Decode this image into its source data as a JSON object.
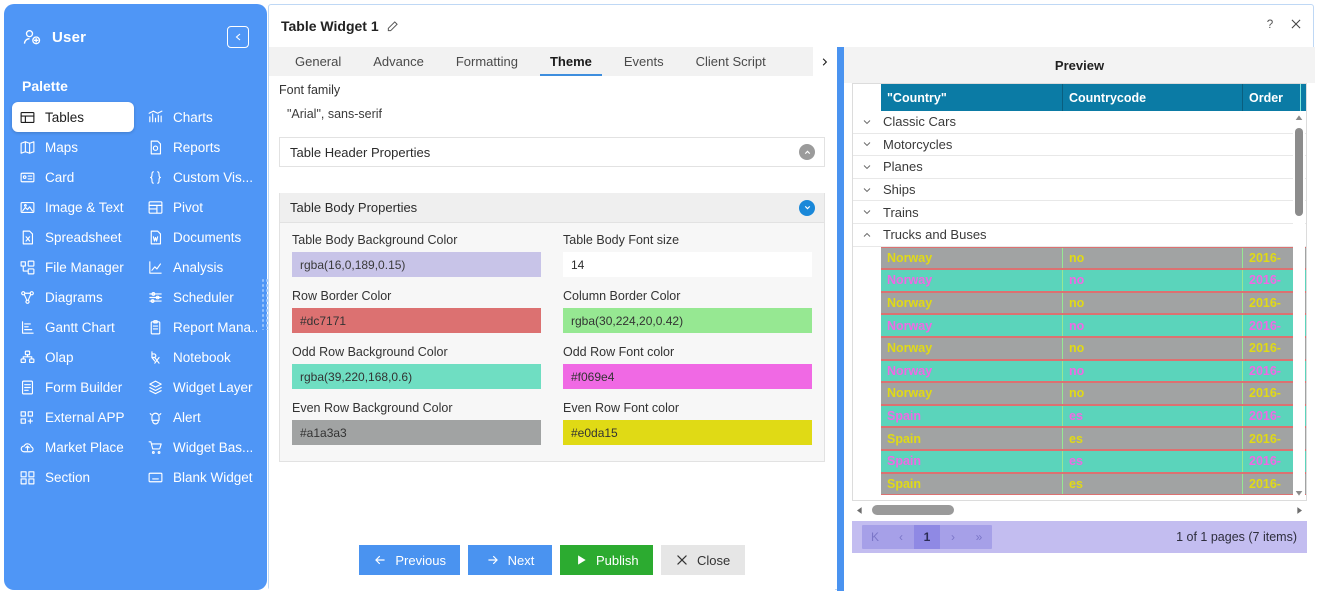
{
  "sidebar": {
    "user_label": "User",
    "user_icon": "user-gear-icon",
    "collapse_icon": "collapse-left-icon",
    "palette_title": "Palette",
    "items": [
      {
        "label": "Tables",
        "icon": "table-icon",
        "active": true
      },
      {
        "label": "Charts",
        "icon": "chart-icon",
        "active": false
      },
      {
        "label": "Maps",
        "icon": "map-icon",
        "active": false
      },
      {
        "label": "Reports",
        "icon": "report-icon",
        "active": false
      },
      {
        "label": "Card",
        "icon": "card-icon",
        "active": false
      },
      {
        "label": "Custom Vis...",
        "icon": "braces-icon",
        "active": false
      },
      {
        "label": "Image & Text",
        "icon": "image-text-icon",
        "active": false
      },
      {
        "label": "Pivot",
        "icon": "pivot-icon",
        "active": false
      },
      {
        "label": "Spreadsheet",
        "icon": "spreadsheet-icon",
        "active": false
      },
      {
        "label": "Documents",
        "icon": "document-icon",
        "active": false
      },
      {
        "label": "File Manager",
        "icon": "file-manager-icon",
        "active": false
      },
      {
        "label": "Analysis",
        "icon": "analysis-icon",
        "active": false
      },
      {
        "label": "Diagrams",
        "icon": "diagram-icon",
        "active": false
      },
      {
        "label": "Scheduler",
        "icon": "scheduler-icon",
        "active": false
      },
      {
        "label": "Gantt Chart",
        "icon": "gantt-icon",
        "active": false
      },
      {
        "label": "Report Mana...",
        "icon": "clipboard-icon",
        "active": false
      },
      {
        "label": "Olap",
        "icon": "olap-icon",
        "active": false
      },
      {
        "label": "Notebook",
        "icon": "notebook-icon",
        "active": false
      },
      {
        "label": "Form Builder",
        "icon": "form-icon",
        "active": false
      },
      {
        "label": "Widget Layer",
        "icon": "layers-icon",
        "active": false
      },
      {
        "label": "External APP",
        "icon": "external-app-icon",
        "active": false
      },
      {
        "label": "Alert",
        "icon": "bell-icon",
        "active": false
      },
      {
        "label": "Market Place",
        "icon": "cloud-up-icon",
        "active": false
      },
      {
        "label": "Widget Bas...",
        "icon": "cart-icon",
        "active": false
      },
      {
        "label": "Section",
        "icon": "section-icon",
        "active": false
      },
      {
        "label": "Blank Widget",
        "icon": "blank-widget-icon",
        "active": false
      }
    ]
  },
  "dialog": {
    "title": "Table Widget 1",
    "edit_icon": "edit-pencil-icon",
    "help_icon": "question-mark-icon",
    "close_icon": "close-x-icon",
    "tabs": [
      {
        "label": "General",
        "active": false
      },
      {
        "label": "Advance",
        "active": false
      },
      {
        "label": "Formatting",
        "active": false
      },
      {
        "label": "Theme",
        "active": true
      },
      {
        "label": "Events",
        "active": false
      },
      {
        "label": "Client Script",
        "active": false
      }
    ],
    "tab_more_icon": "chevron-right-icon",
    "font_family": {
      "label": "Font family",
      "value": "\"Arial\", sans-serif"
    },
    "sections": [
      {
        "title": "Table Header Properties",
        "open": false,
        "chevron": "chevron-up-icon"
      },
      {
        "title": "Table Body Properties",
        "open": true,
        "chevron": "chevron-down-icon"
      }
    ],
    "body_properties": [
      {
        "label": "Table Body Background Color",
        "value": "rgba(16,0,189,0.15)",
        "swatch": "#c8c4e8",
        "text_color": "#3a3a3a"
      },
      {
        "label": "Table Body Font size",
        "value": "14",
        "swatch": "#ffffff",
        "text_color": "#2d2d2d"
      },
      {
        "label": "Row Border Color",
        "value": "#dc7171",
        "swatch": "#dc7171",
        "text_color": "#333333"
      },
      {
        "label": "Column Border Color",
        "value": "rgba(30,224,20,0.42)",
        "swatch": "#96e892",
        "text_color": "#333333"
      },
      {
        "label": "Odd Row Background Color",
        "value": "rgba(39,220,168,0.6)",
        "swatch": "#6fdec2",
        "text_color": "#333333"
      },
      {
        "label": "Odd Row Font color",
        "value": "#f069e4",
        "swatch": "#f069e4",
        "text_color": "#333333"
      },
      {
        "label": "Even Row Background Color",
        "value": "#a1a3a3",
        "swatch": "#a1a3a3",
        "text_color": "#333333"
      },
      {
        "label": "Even Row Font color",
        "value": "#e0da15",
        "swatch": "#e0da15",
        "text_color": "#333333"
      }
    ],
    "footer_buttons": [
      {
        "label": "Previous",
        "icon": "arrow-left-icon",
        "style": "blue"
      },
      {
        "label": "Next",
        "icon": "arrow-right-icon",
        "style": "blue"
      },
      {
        "label": "Publish",
        "icon": "play-icon",
        "style": "green"
      },
      {
        "label": "Close",
        "icon": "close-x-icon",
        "style": "grey"
      }
    ]
  },
  "preview": {
    "title": "Preview",
    "columns": [
      "\"Country\"",
      "Countrycode",
      "Order"
    ],
    "group_rows": [
      {
        "label": "Classic Cars",
        "expanded": false,
        "chevron": "chevron-down-icon"
      },
      {
        "label": "Motorcycles",
        "expanded": false,
        "chevron": "chevron-down-icon"
      },
      {
        "label": "Planes",
        "expanded": false,
        "chevron": "chevron-down-icon"
      },
      {
        "label": "Ships",
        "expanded": false,
        "chevron": "chevron-down-icon"
      },
      {
        "label": "Trains",
        "expanded": false,
        "chevron": "chevron-down-icon"
      },
      {
        "label": "Trucks and Buses",
        "expanded": true,
        "chevron": "chevron-up-icon"
      }
    ],
    "data_rows": [
      {
        "country": "Norway",
        "countrycode": "no",
        "order": "2016-",
        "parity": "even"
      },
      {
        "country": "Norway",
        "countrycode": "no",
        "order": "2016-",
        "parity": "odd"
      },
      {
        "country": "Norway",
        "countrycode": "no",
        "order": "2016-",
        "parity": "even"
      },
      {
        "country": "Norway",
        "countrycode": "no",
        "order": "2016-",
        "parity": "odd"
      },
      {
        "country": "Norway",
        "countrycode": "no",
        "order": "2016-",
        "parity": "even"
      },
      {
        "country": "Norway",
        "countrycode": "no",
        "order": "2016-",
        "parity": "odd"
      },
      {
        "country": "Norway",
        "countrycode": "no",
        "order": "2016-",
        "parity": "even"
      },
      {
        "country": "Spain",
        "countrycode": "es",
        "order": "2016-",
        "parity": "odd"
      },
      {
        "country": "Spain",
        "countrycode": "es",
        "order": "2016-",
        "parity": "even"
      },
      {
        "country": "Spain",
        "countrycode": "es",
        "order": "2016-",
        "parity": "odd"
      },
      {
        "country": "Spain",
        "countrycode": "es",
        "order": "2016-",
        "parity": "even"
      }
    ],
    "theme_colors": {
      "header_bg": "#0b7ba5",
      "header_fg": "#ffffff",
      "odd_row_bg": "#5bd4bb",
      "odd_row_fg": "#f069e4",
      "even_row_bg": "#a1a3a3",
      "even_row_fg": "#e0da15",
      "row_border": "#dc7171",
      "column_border": "#96e892"
    },
    "pager": {
      "first_label": "K",
      "prev_label": "‹",
      "current_page": "1",
      "next_label": "›",
      "last_label": "»",
      "info": "1 of 1 pages (7 items)"
    },
    "hscroll_left_icon": "scroll-left-arrow-icon",
    "hscroll_right_icon": "scroll-right-arrow-icon",
    "vscroll_up_icon": "scroll-up-arrow-icon",
    "vscroll_down_icon": "scroll-down-arrow-icon"
  }
}
